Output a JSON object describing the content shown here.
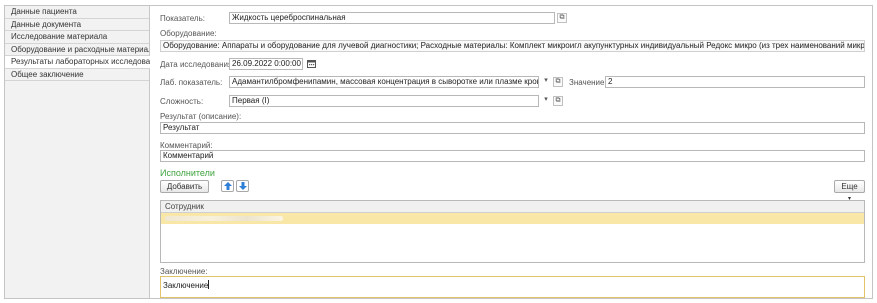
{
  "nav": {
    "items": [
      {
        "label": "Данные пациента"
      },
      {
        "label": "Данные документа"
      },
      {
        "label": "Исследование материала"
      },
      {
        "label": "Оборудование и расходные материалы"
      },
      {
        "label": "Результаты лабораторных исследований"
      },
      {
        "label": "Общее заключение"
      }
    ]
  },
  "form": {
    "indicator": {
      "label": "Показатель:",
      "value": "Жидкость цереброспинальная"
    },
    "equipment": {
      "label": "Оборудование:",
      "value": "Оборудование: Аппараты и оборудование для лучевой диагностики; Расходные материалы: Комплект микроигл акупунктурных индивидуальный Редокс микро (из трех наименований микроигл)"
    },
    "study_date": {
      "label": "Дата исследования:",
      "value": "26.09.2022  0:00:00"
    },
    "lab_indicator": {
      "label": "Лаб. показатель:",
      "value": "Адамантилбромфенипамин, массовая концентрация в сыворотке или плазме крови"
    },
    "value": {
      "label": "Значение:",
      "value": "2"
    },
    "complexity": {
      "label": "Сложность:",
      "value": "Первая (I)"
    },
    "result": {
      "label": "Результат (описание):",
      "value": "Результат"
    },
    "comment": {
      "label": "Комментарий:",
      "value": "Комментарий"
    }
  },
  "performers": {
    "title": "Исполнители",
    "add_label": "Добавить",
    "more_label": "Еще",
    "column_header": "Сотрудник"
  },
  "conclusion": {
    "label": "Заключение:",
    "value": "Заключение"
  },
  "icons": {
    "open": "open-form-icon",
    "calendar": "calendar-icon",
    "dropdown": "dropdown-arrow-icon",
    "move_up": "arrow-up-icon",
    "move_down": "arrow-down-icon"
  },
  "colors": {
    "section_title": "#3fa33f",
    "selected_row": "#f9e7a8",
    "focus_border": "#e2c36a",
    "arrow": "#2f7fd6"
  }
}
